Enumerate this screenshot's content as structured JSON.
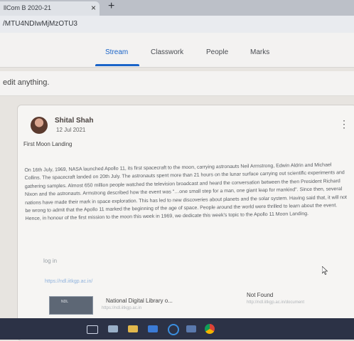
{
  "browser": {
    "tab_title": "llCom B 2020-21",
    "tab_close": "×",
    "new_tab": "+",
    "url": "/MTU4NDIwMjMzOTU3"
  },
  "classroom": {
    "tabs": [
      "Stream",
      "Classwork",
      "People",
      "Marks"
    ],
    "active_tab": "Stream",
    "banner_text": "edit anything."
  },
  "post": {
    "author": "Shital Shah",
    "date": "12 Jul 2021",
    "title": "First Moon Landing",
    "body": "On 16th July, 1969, NASA launched Apollo 11, its first spacecraft to the moon, carrying astronauts Neil Armstrong, Edwin Aldrin and Michael Collins. The spacecraft landed on 20th July. The astronauts spent more than 21 hours on the lunar surface carrying out scientific experiments and gathering samples. Almost 650 million people watched the television broadcast and heard the conversation between the then President Richard Nixon and the astronauts. Armstrong described how the event was \"…one small step for a man, one giant leap for mankind\". Since then, several nations have made their mark in space exploration. This has led to new discoveries about planets and the solar system. Having said that, it will not be wrong to admit that the Apollo 11 marked the beginning of the age of space. People around the world were thrilled to learn about the event. Hence, in honour of the first mission to the moon this week in 1969, we dedicate this week's topic to the Apollo 11 Moon Landing.",
    "log_in": "log in",
    "link_url": "https://ndl.iitkgp.ac.in/",
    "attachments": [
      {
        "title": "National Digital Library o...",
        "url": "https://ndl.iitkgp.ac.in",
        "thumb_text": "NDL"
      },
      {
        "title": "Not Found",
        "url": "http://ndl.iitkgp.ac.in/document"
      }
    ]
  },
  "colors": {
    "accent": "#1a64c8",
    "taskbar": "#2c3246"
  },
  "taskbar_icons": [
    "task-view-icon",
    "calculator-icon",
    "file-explorer-icon",
    "mail-icon",
    "edge-icon",
    "store-icon",
    "chrome-icon"
  ]
}
